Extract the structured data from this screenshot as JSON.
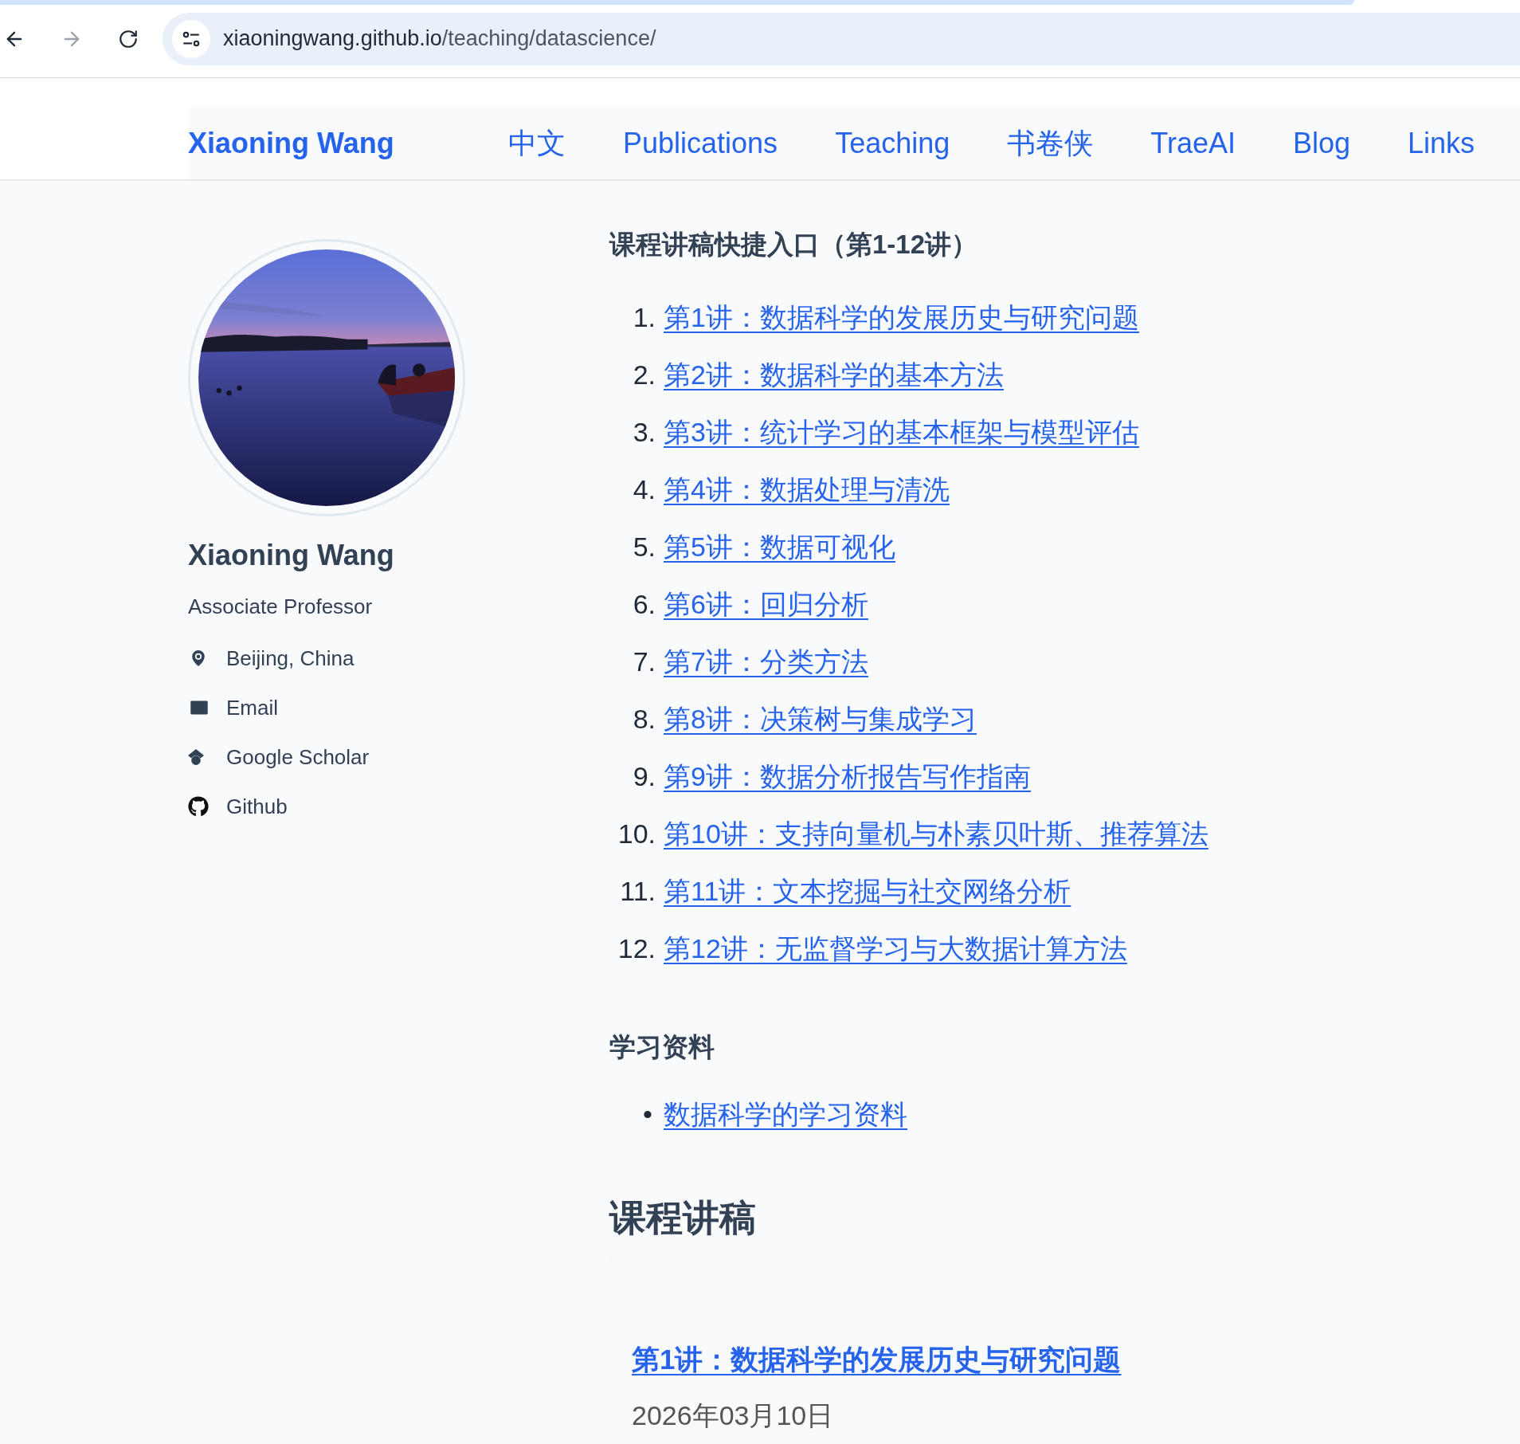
{
  "browser": {
    "url_host": "xiaoningwang.github.io",
    "url_path": "/teaching/datascience/"
  },
  "nav": {
    "brand": "Xiaoning Wang",
    "links": [
      "中文",
      "Publications",
      "Teaching",
      "书卷侠",
      "TraeAI",
      "Blog",
      "Links"
    ]
  },
  "profile": {
    "name": "Xiaoning Wang",
    "title": "Associate Professor",
    "items": [
      {
        "kind": "location",
        "label": "Beijing, China"
      },
      {
        "kind": "email",
        "label": "Email"
      },
      {
        "kind": "scholar",
        "label": "Google Scholar"
      },
      {
        "kind": "github",
        "label": "Github"
      }
    ]
  },
  "quick_links": {
    "heading": "课程讲稿快捷入口（第1-12讲）",
    "items": [
      {
        "number": "1.",
        "label": "第1讲：数据科学的发展历史与研究问题"
      },
      {
        "number": "2.",
        "label": "第2讲：数据科学的基本方法"
      },
      {
        "number": "3.",
        "label": "第3讲：统计学习的基本框架与模型评估"
      },
      {
        "number": "4.",
        "label": "第4讲：数据处理与清洗"
      },
      {
        "number": "5.",
        "label": "第5讲：数据可视化"
      },
      {
        "number": "6.",
        "label": "第6讲：回归分析"
      },
      {
        "number": "7.",
        "label": "第7讲：分类方法"
      },
      {
        "number": "8.",
        "label": "第8讲：决策树与集成学习"
      },
      {
        "number": "9.",
        "label": "第9讲：数据分析报告写作指南"
      },
      {
        "number": "10.",
        "label": "第10讲：支持向量机与朴素贝叶斯、推荐算法"
      },
      {
        "number": "11.",
        "label": "第11讲：文本挖掘与社交网络分析"
      },
      {
        "number": "12.",
        "label": "第12讲：无监督学习与大数据计算方法"
      }
    ]
  },
  "materials": {
    "heading": "学习资料",
    "items": [
      {
        "bullet": "•",
        "label": "数据科学的学习资料"
      }
    ]
  },
  "lectures": {
    "heading": "课程讲稿",
    "posts": [
      {
        "title": "第1讲：数据科学的发展历史与研究问题",
        "date": "2026年03月10日"
      }
    ]
  }
}
